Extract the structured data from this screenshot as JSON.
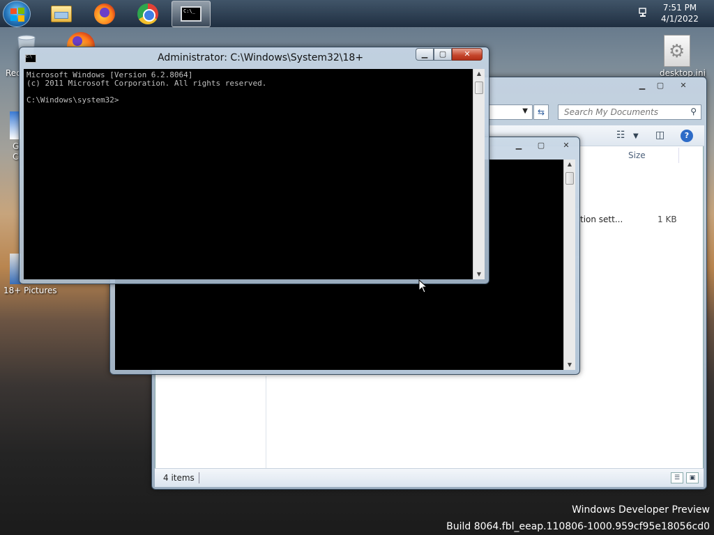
{
  "taskbar": {
    "start_icon": "windows-logo-icon",
    "apps": [
      {
        "name": "windows-explorer",
        "icon": "folder-icon"
      },
      {
        "name": "firefox",
        "icon": "firefox-icon"
      },
      {
        "name": "chrome",
        "icon": "chrome-icon"
      },
      {
        "name": "command-prompt",
        "icon": "cmd-icon",
        "active": true
      }
    ],
    "tray_icon": "network-icon",
    "clock_time": "7:51 PM",
    "clock_date": "4/1/2022"
  },
  "desktop": {
    "recycle_label": "Rec",
    "left_label_1": "G",
    "left_label_2": "C",
    "pictures_label": "18+ Pictures",
    "desktop_ini_label": "desktop.ini"
  },
  "explorer": {
    "search_placeholder": "Search My Documents",
    "column_size": "Size",
    "file_name_partial": "tion sett...",
    "file_size": "1 KB",
    "status_items": "4 items"
  },
  "cmd_front": {
    "title": "Administrator: C:\\Windows\\System32\\18+",
    "console_text": "Microsoft Windows [Version 6.2.8064]\n(c) 2011 Microsoft Corporation. All rights reserved.\n\nC:\\Windows\\system32>"
  },
  "watermark": {
    "line1": "Windows Developer Preview",
    "line2": "Build 8064.fbl_eeap.110806-1000.959cf95e18056cd0"
  },
  "colors": {
    "console_bg": "#000000",
    "console_fg": "#c0c0c0",
    "close_button": "#c4442a"
  }
}
